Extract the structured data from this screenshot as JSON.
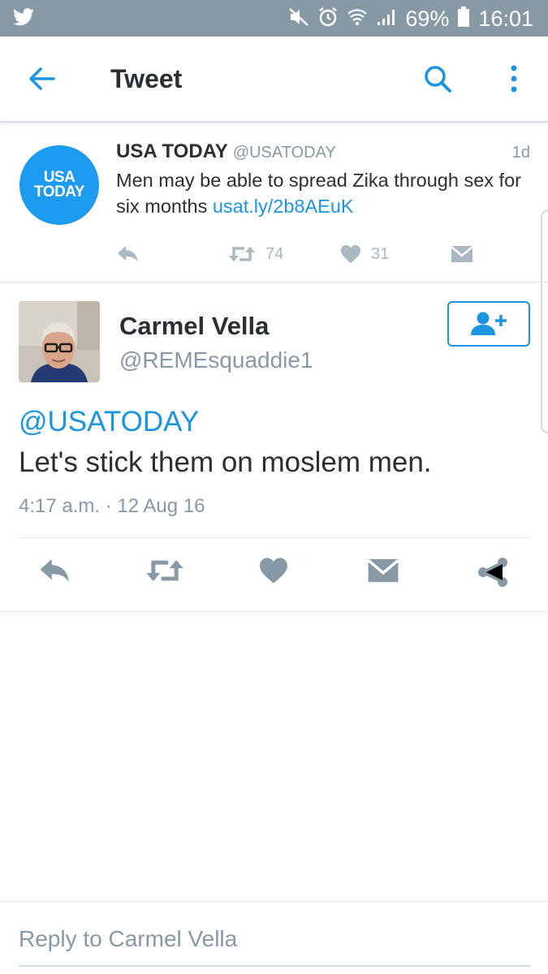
{
  "status_bar": {
    "battery": "69%",
    "time": "16:01"
  },
  "app_bar": {
    "title": "Tweet"
  },
  "quoted_tweet": {
    "avatar_lines": [
      "USA",
      "TODAY"
    ],
    "display_name": "USA TODAY",
    "handle": "@USATODAY",
    "age": "1d",
    "text": "Men may be able to spread Zika through sex for six months ",
    "link": "usat.ly/2b8AEuK",
    "retweets": "74",
    "likes": "31"
  },
  "tweet": {
    "display_name": "Carmel Vella",
    "handle": "@REMEsquaddie1",
    "mention": "@USATODAY",
    "text": "Let's stick them on moslem men.",
    "timestamp": "4:17 a.m. · 12 Aug 16"
  },
  "reply_bar": {
    "placeholder": "Reply to Carmel Vella"
  },
  "colors": {
    "accent": "#1b95e0",
    "status_bar": "#8899a6",
    "icon_gray": "#8899a6"
  }
}
